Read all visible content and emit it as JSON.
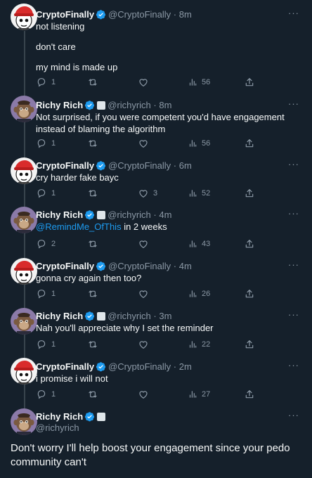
{
  "colors": {
    "background": "#15202b",
    "secondary": "#8b98a5",
    "accent": "#1d9bf0",
    "verified": "#1d9bf0"
  },
  "tweets": [
    {
      "name": "CryptoFinally",
      "handle": "@CryptoFinally",
      "time": "8m",
      "lines": [
        "not listening",
        "don't care",
        "my mind is made up"
      ],
      "replies": "1",
      "retweets": "",
      "likes": "",
      "views": "56"
    },
    {
      "name": "Richy Rich",
      "handle": "@richyrich",
      "time": "8m",
      "text": "Not surprised, if you were competent you'd have engagement instead of blaming the algorithm",
      "replies": "1",
      "retweets": "",
      "likes": "",
      "views": "56"
    },
    {
      "name": "CryptoFinally",
      "handle": "@CryptoFinally",
      "time": "6m",
      "text": "cry harder fake bayc",
      "replies": "1",
      "retweets": "",
      "likes": "3",
      "views": "52"
    },
    {
      "name": "Richy Rich",
      "handle": "@richyrich",
      "time": "4m",
      "mention": "@RemindMe_OfThis",
      "text": " in 2 weeks",
      "replies": "2",
      "retweets": "",
      "likes": "",
      "views": "43"
    },
    {
      "name": "CryptoFinally",
      "handle": "@CryptoFinally",
      "time": "4m",
      "text": "gonna cry again then too?",
      "replies": "1",
      "retweets": "",
      "likes": "",
      "views": "26"
    },
    {
      "name": "Richy Rich",
      "handle": "@richyrich",
      "time": "3m",
      "text": "Nah you'll appreciate why I set the reminder",
      "replies": "1",
      "retweets": "",
      "likes": "",
      "views": "22"
    },
    {
      "name": "CryptoFinally",
      "handle": "@CryptoFinally",
      "time": "2m",
      "text": "i promise i will not",
      "replies": "1",
      "retweets": "",
      "likes": "",
      "views": "27"
    }
  ],
  "final": {
    "name": "Richy Rich",
    "handle": "@richyrich",
    "text": "Don't worry I'll help boost your engagement since your pedo community can't"
  },
  "separator": "·",
  "more_label": "···"
}
